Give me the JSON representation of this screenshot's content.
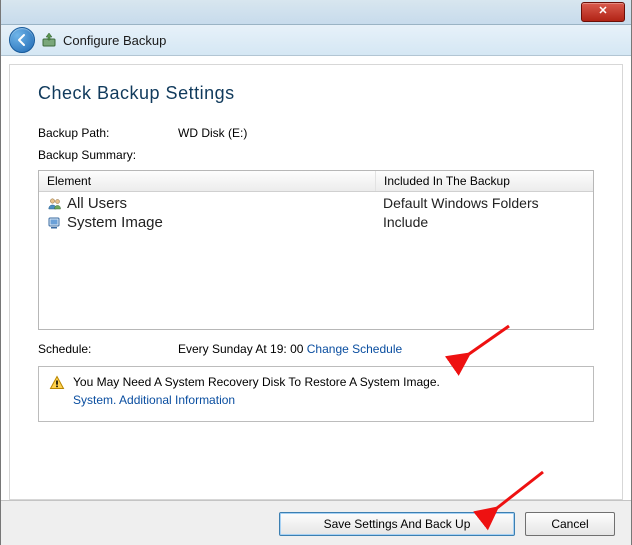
{
  "window": {
    "close_glyph": "✕"
  },
  "toolbar": {
    "title": "Configure Backup"
  },
  "page": {
    "heading": "Check Backup Settings"
  },
  "backup_path": {
    "label": "Backup Path:",
    "value": "WD Disk (E:)"
  },
  "backup_summary_label": "Backup Summary:",
  "summary": {
    "headers": {
      "element": "Element",
      "included": "Included In The Backup"
    },
    "rows": [
      {
        "icon": "users-icon",
        "name": "All Users",
        "included": "Default Windows Folders"
      },
      {
        "icon": "system-image-icon",
        "name": "System Image",
        "included": "Include"
      }
    ]
  },
  "schedule": {
    "label": "Schedule:",
    "text": "Every Sunday At 19: 00 ",
    "link": "Change Schedule"
  },
  "info": {
    "text": "You May Need A System Recovery Disk To Restore A System Image.",
    "link": "System. Additional Information"
  },
  "buttons": {
    "save": "Save Settings And Back Up",
    "cancel": "Cancel"
  }
}
